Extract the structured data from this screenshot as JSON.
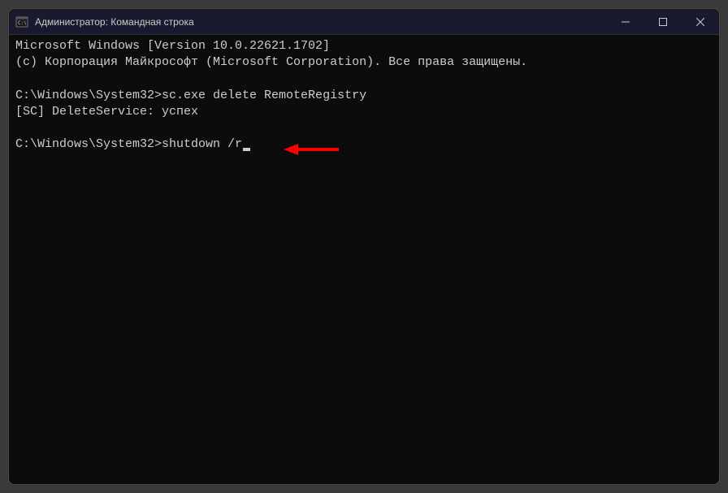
{
  "window": {
    "title": "Администратор: Командная строка"
  },
  "terminal": {
    "line1": "Microsoft Windows [Version 10.0.22621.1702]",
    "line2": "(c) Корпорация Майкрософт (Microsoft Corporation). Все права защищены.",
    "prompt1": "C:\\Windows\\System32>",
    "command1": "sc.exe delete RemoteRegistry",
    "output1": "[SC] DeleteService: успех",
    "prompt2": "C:\\Windows\\System32>",
    "command2": "shutdown /r"
  }
}
